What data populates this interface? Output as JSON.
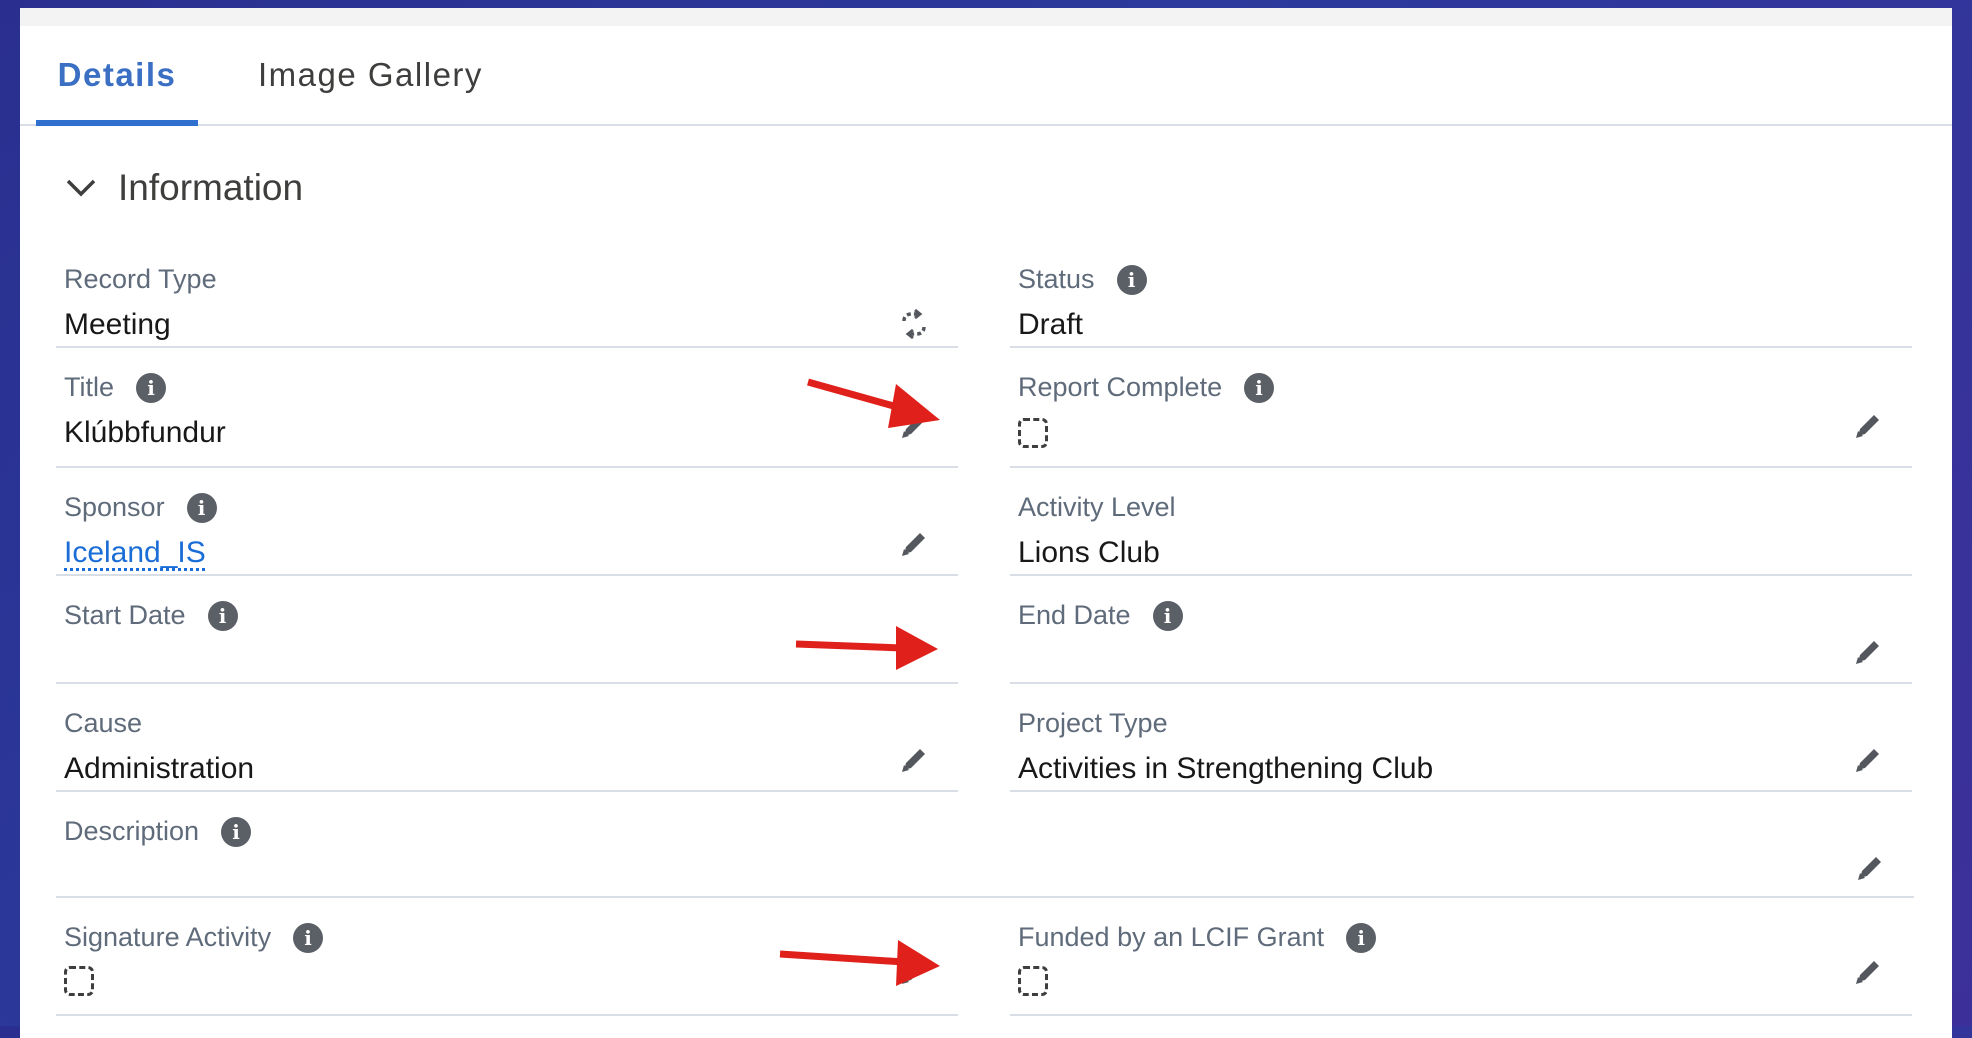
{
  "tabs": [
    {
      "label": "Details",
      "active": true
    },
    {
      "label": "Image Gallery",
      "active": false
    }
  ],
  "section": {
    "title": "Information",
    "expanded": true
  },
  "fields": {
    "record_type": {
      "label": "Record Type",
      "value": "Meeting",
      "icon": "change-record-type-icon"
    },
    "status": {
      "label": "Status",
      "value": "Draft",
      "has_info": true
    },
    "title": {
      "label": "Title",
      "value": "Klúbbfundur",
      "has_info": true
    },
    "report_complete": {
      "label": "Report Complete",
      "checked": false,
      "has_info": true
    },
    "sponsor": {
      "label": "Sponsor",
      "value": "Iceland_IS",
      "is_link": true,
      "has_info": true
    },
    "activity_level": {
      "label": "Activity Level",
      "value": "Lions Club"
    },
    "start_date": {
      "label": "Start Date",
      "value": "",
      "has_info": true
    },
    "end_date": {
      "label": "End Date",
      "value": "",
      "has_info": true
    },
    "cause": {
      "label": "Cause",
      "value": "Administration"
    },
    "project_type": {
      "label": "Project Type",
      "value": "Activities in Strengthening Club"
    },
    "description": {
      "label": "Description",
      "value": "",
      "has_info": true
    },
    "signature_activity": {
      "label": "Signature Activity",
      "checked": false,
      "has_info": true
    },
    "funded_by_lcif": {
      "label": "Funded by an LCIF Grant",
      "checked": false,
      "has_info": true
    }
  },
  "annotations": {
    "arrow_color": "#e0201b"
  },
  "colors": {
    "accent": "#2f6fce",
    "link": "#1a6dd6"
  }
}
